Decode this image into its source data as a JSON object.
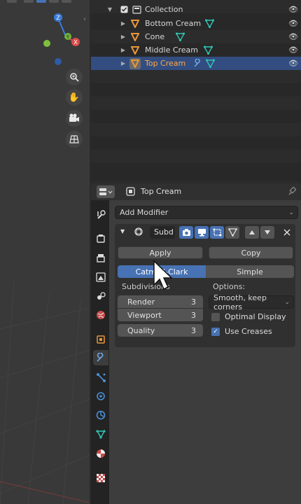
{
  "outliner": {
    "collection_label": "Collection",
    "items": [
      {
        "label": "Bottom Cream"
      },
      {
        "label": "Cone"
      },
      {
        "label": "Middle Cream"
      },
      {
        "label": "Top Cream"
      }
    ]
  },
  "properties": {
    "object_name": "Top Cream",
    "add_modifier_label": "Add Modifier",
    "modifier": {
      "name": "Subd",
      "apply_label": "Apply",
      "copy_label": "Copy",
      "mode_catmull": "Catmull-Clark",
      "mode_simple": "Simple",
      "subdivisions_label": "Subdivisions",
      "options_label": "Options:",
      "fields": [
        {
          "label": "Render",
          "value": "3"
        },
        {
          "label": "Viewport",
          "value": "3"
        },
        {
          "label": "Quality",
          "value": "3"
        }
      ],
      "uv_smooth": "Smooth, keep corners",
      "optimal_display_label": "Optimal Display",
      "optimal_display_checked": false,
      "use_creases_label": "Use Creases",
      "use_creases_checked": true
    }
  },
  "colors": {
    "accent": "#4772b3",
    "selected_row": "#334d80",
    "object_orange": "#e8963a",
    "mesh_teal": "#2ec7b5"
  }
}
